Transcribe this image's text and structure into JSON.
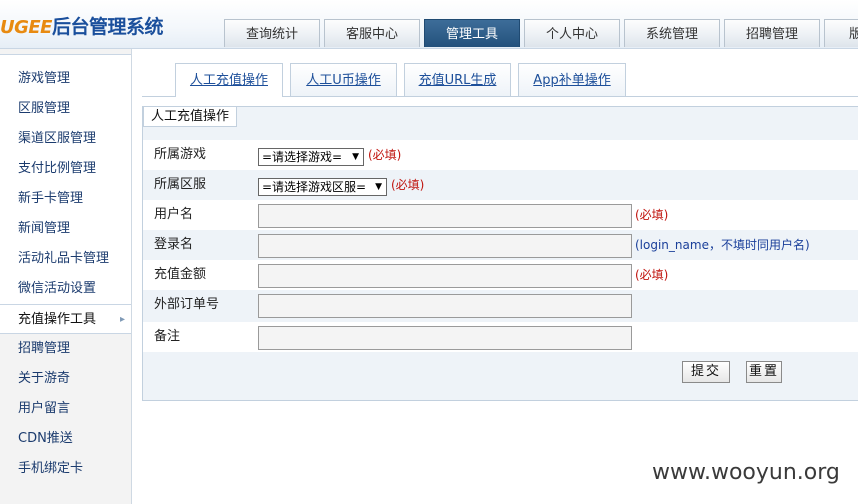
{
  "logo": {
    "brand": "UGEE",
    "text": "后台管理系统"
  },
  "topnav": [
    {
      "label": "查询统计"
    },
    {
      "label": "客服中心"
    },
    {
      "label": "管理工具"
    },
    {
      "label": "个人中心"
    },
    {
      "label": "系统管理"
    },
    {
      "label": "招聘管理"
    },
    {
      "label": "版"
    }
  ],
  "sidebar": {
    "items": [
      {
        "label": "游戏管理"
      },
      {
        "label": "区服管理"
      },
      {
        "label": "渠道区服管理"
      },
      {
        "label": "支付比例管理"
      },
      {
        "label": "新手卡管理"
      },
      {
        "label": "新闻管理"
      },
      {
        "label": "活动礼品卡管理"
      },
      {
        "label": "微信活动设置"
      },
      {
        "label": "充值操作工具"
      },
      {
        "label": "招聘管理"
      },
      {
        "label": "关于游奇"
      },
      {
        "label": "用户留言"
      },
      {
        "label": "CDN推送"
      },
      {
        "label": "手机绑定卡"
      }
    ],
    "active_arrow": "▸"
  },
  "subtabs": [
    {
      "label": "人工充值操作"
    },
    {
      "label": "人工U币操作"
    },
    {
      "label": "充值URL生成"
    },
    {
      "label": "App补单操作"
    }
  ],
  "panel": {
    "title": "人工充值操作",
    "game": {
      "label": "所属游戏",
      "selected": "=请选择游戏=",
      "required": "(必填)"
    },
    "server": {
      "label": "所属区服",
      "selected": "=请选择游戏区服=",
      "required": "(必填)"
    },
    "username": {
      "label": "用户名",
      "value": "",
      "required": "(必填)"
    },
    "loginname": {
      "label": "登录名",
      "value": "",
      "hint": "(login_name，不填时同用户名)"
    },
    "amount": {
      "label": "充值金额",
      "value": "",
      "required": "(必填)"
    },
    "order": {
      "label": "外部订单号",
      "value": ""
    },
    "remark": {
      "label": "备注",
      "value": ""
    },
    "submit_label": "提交",
    "reset_label": "重置"
  },
  "watermark": "www.wooyun.org",
  "colors": {
    "accent": "#23517c",
    "link": "#1d4f9a",
    "required": "#c0140e",
    "hint": "#1a3f9a"
  }
}
